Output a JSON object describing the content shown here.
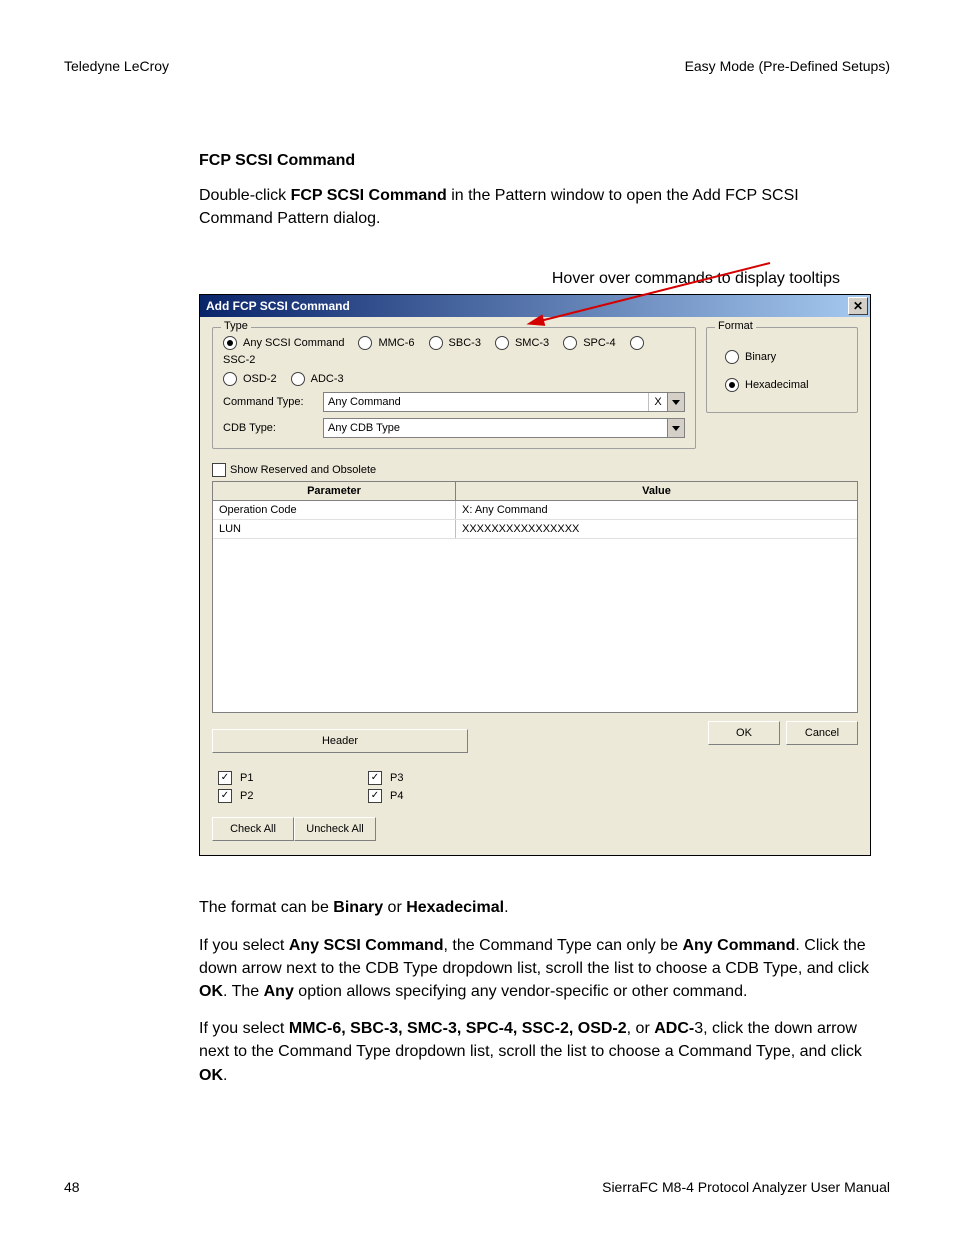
{
  "header": {
    "left": "Teledyne LeCroy",
    "right": "Easy Mode (Pre-Defined Setups)"
  },
  "section_title": "FCP SCSI Command",
  "intro": {
    "pre": "Double-click ",
    "bold": "FCP SCSI Command",
    "post": " in the Pattern window to open the Add FCP SCSI Command Pattern dialog."
  },
  "tooltip_caption": "Hover over commands to display tooltips",
  "dialog": {
    "title": "Add FCP SCSI Command",
    "type_legend": "Type",
    "format_legend": "Format",
    "radios": {
      "any": "Any SCSI Command",
      "mmc6": "MMC-6",
      "sbc3": "SBC-3",
      "smc3": "SMC-3",
      "spc4": "SPC-4",
      "ssc2": "SSC-2",
      "osd2": "OSD-2",
      "adc3": "ADC-3"
    },
    "cmd_type_label": "Command Type:",
    "cmd_type_value": "Any Command",
    "cmd_type_clear": "X",
    "cdb_type_label": "CDB Type:",
    "cdb_type_value": "Any CDB Type",
    "show_reserved": "Show Reserved and Obsolete",
    "table": {
      "col1": "Parameter",
      "col2": "Value",
      "rows": [
        {
          "param": "Operation Code",
          "value": "X: Any Command"
        },
        {
          "param": "LUN",
          "value": "XXXXXXXXXXXXXXXX"
        }
      ]
    },
    "header_btn": "Header",
    "ok": "OK",
    "cancel": "Cancel",
    "ports": {
      "p1": "P1",
      "p2": "P2",
      "p3": "P3",
      "p4": "P4"
    },
    "check_all": "Check All",
    "uncheck_all": "Uncheck All",
    "format": {
      "binary": "Binary",
      "hex": "Hexadecimal"
    }
  },
  "body_paras": {
    "p1_pre": "The format can be ",
    "p1_b1": "Binary",
    "p1_mid": " or ",
    "p1_b2": "Hexadecimal",
    "p1_post": ".",
    "p2_pre": "If you select ",
    "p2_b1": "Any SCSI Command",
    "p2_mid1": ", the Command Type can only be ",
    "p2_b2": "Any Command",
    "p2_mid2": ". Click the down arrow next to the CDB Type dropdown list, scroll the list to choose a CDB Type, and click ",
    "p2_b3": "OK",
    "p2_mid3": ". The ",
    "p2_b4": "Any",
    "p2_post": " option allows specifying any vendor-specific or other command.",
    "p3_pre": "If you select ",
    "p3_b1": "MMC-6, SBC-3, SMC-3, SPC-4, SSC-2, OSD-2",
    "p3_mid1": ", or ",
    "p3_b2": "ADC-",
    "p3_mid2": "3, click the down arrow next to the Command Type dropdown list, scroll the list to choose a Command Type, and click ",
    "p3_b3": "OK",
    "p3_post": "."
  },
  "footer": {
    "page": "48",
    "manual": "SierraFC M8-4 Protocol Analyzer User Manual"
  }
}
